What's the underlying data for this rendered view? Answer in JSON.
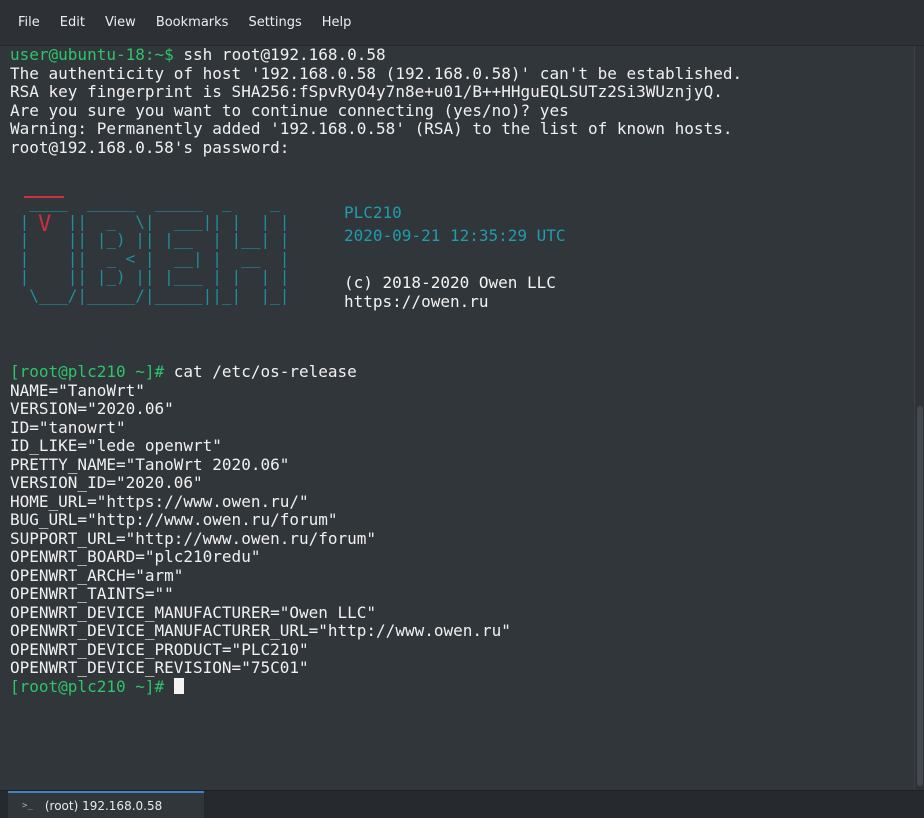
{
  "menubar": {
    "items": [
      "File",
      "Edit",
      "View",
      "Bookmarks",
      "Settings",
      "Help"
    ]
  },
  "session": {
    "user_prompt": "user@ubuntu-18:~$",
    "ssh_command": " ssh root@192.168.0.58",
    "ssh_output": [
      "The authenticity of host '192.168.0.58 (192.168.0.58)' can't be established.",
      "RSA key fingerprint is SHA256:fSpvRyO4y7n8e+u01/B++HHguEQLSUTz2Si3WUznjyQ.",
      "Are you sure you want to continue connecting (yes/no)? yes",
      "Warning: Permanently added '192.168.0.58' (RSA) to the list of known hosts.",
      "root@192.168.0.58's password:"
    ],
    "banner": {
      "device": "PLC210",
      "datetime": "2020-09-21 12:35:29 UTC",
      "copyright": "(c) 2018-2020 Owen LLC",
      "url": "https://owen.ru"
    },
    "root_prompt": "[root@plc210 ~]#",
    "cat_command": " cat /etc/os-release",
    "os_release": [
      "NAME=\"TanoWrt\"",
      "VERSION=\"2020.06\"",
      "ID=\"tanowrt\"",
      "ID_LIKE=\"lede openwrt\"",
      "PRETTY_NAME=\"TanoWrt 2020.06\"",
      "VERSION_ID=\"2020.06\"",
      "HOME_URL=\"https://www.owen.ru/\"",
      "BUG_URL=\"http://www.owen.ru/forum\"",
      "SUPPORT_URL=\"http://www.owen.ru/forum\"",
      "OPENWRT_BOARD=\"plc210redu\"",
      "OPENWRT_ARCH=\"arm\"",
      "OPENWRT_TAINTS=\"\"",
      "OPENWRT_DEVICE_MANUFACTURER=\"Owen LLC\"",
      "OPENWRT_DEVICE_MANUFACTURER_URL=\"http://www.owen.ru\"",
      "OPENWRT_DEVICE_PRODUCT=\"PLC210\"",
      "OPENWRT_DEVICE_REVISION=\"75C01\""
    ],
    "final_prompt": "[root@plc210 ~]#"
  },
  "tabs": [
    {
      "label": "(root) 192.168.0.58",
      "icon": "terminal-icon"
    }
  ],
  "colors": {
    "prompt_green": "#2ec46a",
    "banner_cyan": "#1f9cad",
    "logo_red": "#c8323c",
    "background": "#31363b"
  }
}
